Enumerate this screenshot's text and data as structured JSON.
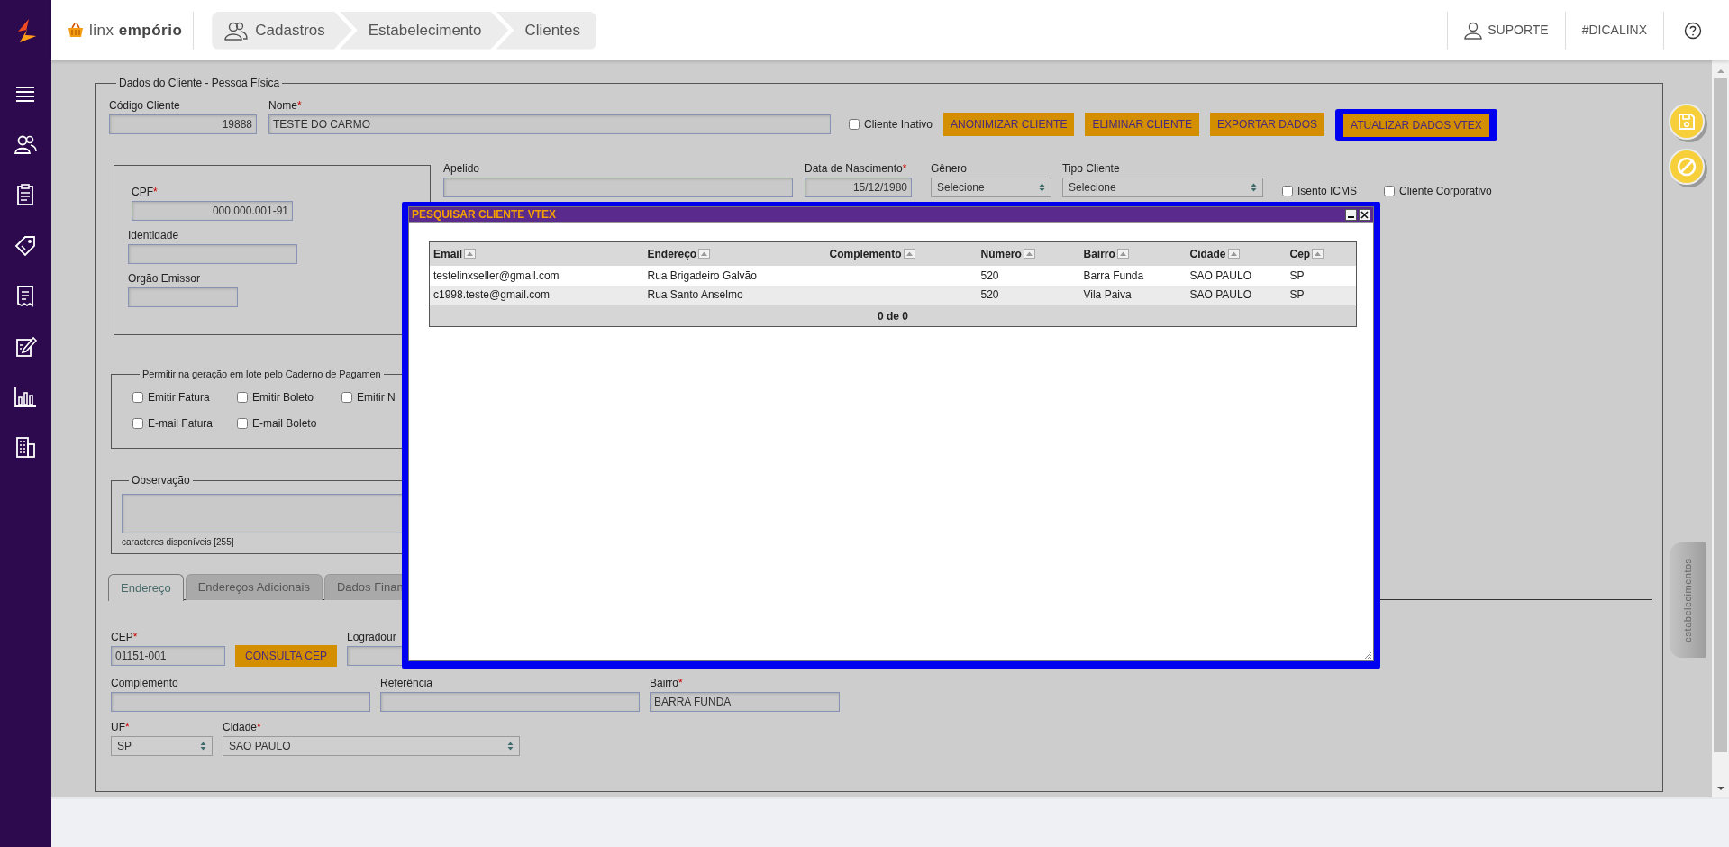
{
  "header": {
    "logo": "linx **empório**",
    "breadcrumb": [
      {
        "label": "Cadastros"
      },
      {
        "label": "Estabelecimento"
      },
      {
        "label": "Clientes"
      }
    ],
    "links": [
      {
        "label": "SUPORTE"
      },
      {
        "label": "#DICALINX"
      }
    ]
  },
  "form": {
    "legend": "Dados do Cliente - Pessoa Física",
    "code": {
      "label": "Código Cliente",
      "value": "19888"
    },
    "name": {
      "label": "Nome",
      "mark": "*",
      "value": "TESTE DO CARMO"
    },
    "inactive": {
      "label": "Cliente Inativo",
      "checked": false
    },
    "actions": [
      {
        "label": "ANONIMIZAR CLIENTE",
        "highlighted": false
      },
      {
        "label": "ELIMINAR CLIENTE",
        "highlighted": false
      },
      {
        "label": "EXPORTAR DADOS",
        "highlighted": false
      },
      {
        "label": "ATUALIZAR DADOS VTEX",
        "highlighted": true
      }
    ],
    "cpf": {
      "label": "CPF",
      "mark": "*",
      "value": "000.000.001-91"
    },
    "identity": {
      "label": "Identidade"
    },
    "issuer": {
      "label": "Orgão Emissor"
    },
    "nickname": {
      "label": "Apelido"
    },
    "birth_date": {
      "label": "Data de Nascimento",
      "mark": "*",
      "value": "15/12/1980"
    },
    "gender": {
      "label": "Gênero",
      "value": "Selecione"
    },
    "client_type": {
      "label": "Tipo Cliente",
      "value": "Selecione"
    },
    "flags": [
      {
        "label": "Isento ICMS",
        "checked": false
      },
      {
        "label": "Cliente Corporativo",
        "checked": false
      }
    ],
    "batch": {
      "legend": "Permitir na geração em lote pelo Caderno de Pagamen",
      "options": [
        {
          "label": "Emitir Fatura",
          "checked": false
        },
        {
          "label": "Emitir Boleto",
          "checked": false
        },
        {
          "label": "Emitir N",
          "checked": false
        },
        {
          "label": "E-mail Fatura",
          "checked": false
        },
        {
          "label": "E-mail Boleto",
          "checked": false
        }
      ]
    },
    "notes": {
      "legend": "Observação",
      "counter": "caracteres disponíveis [255]"
    },
    "tabs": [
      {
        "label": "Endereço",
        "selected": true
      },
      {
        "label": "Endereços Adicionais",
        "selected": false
      },
      {
        "label": "Dados Finan",
        "selected": false
      }
    ],
    "address": {
      "cep": {
        "label": "CEP",
        "mark": "*",
        "value": "01151-001"
      },
      "lookup_button": "CONSULTA CEP",
      "street": {
        "label": "Logradour"
      },
      "complement": {
        "label": "Complemento"
      },
      "reference": {
        "label": "Referência"
      },
      "district": {
        "label": "Bairro",
        "mark": "*",
        "value": "BARRA FUNDA"
      },
      "state": {
        "label": "UF",
        "mark": "*",
        "value": "SP"
      },
      "city": {
        "label": "Cidade",
        "mark": "*",
        "value": "SAO PAULO"
      }
    }
  },
  "side_tab": "estabelecimentos",
  "modal": {
    "title": "PESQUISAR CLIENTE VTEX",
    "columns": [
      {
        "label": "Email"
      },
      {
        "label": "Endereço"
      },
      {
        "label": "Complemento"
      },
      {
        "label": "Número"
      },
      {
        "label": "Bairro"
      },
      {
        "label": "Cidade"
      },
      {
        "label": "Cep"
      }
    ],
    "rows": [
      {
        "email": "testelinxseller@gmail.com",
        "endereco": "Rua Brigadeiro Galvão",
        "numero": "520",
        "bairro": "Barra Funda",
        "cidade": "SAO PAULO",
        "cep": "SP"
      },
      {
        "email": "c1998.teste@gmail.com",
        "endereco": "Rua Santo Anselmo",
        "numero": "520",
        "bairro": "Vila Paiva",
        "cidade": "SAO PAULO",
        "cep": "SP"
      }
    ],
    "footer": "0 de 0"
  }
}
